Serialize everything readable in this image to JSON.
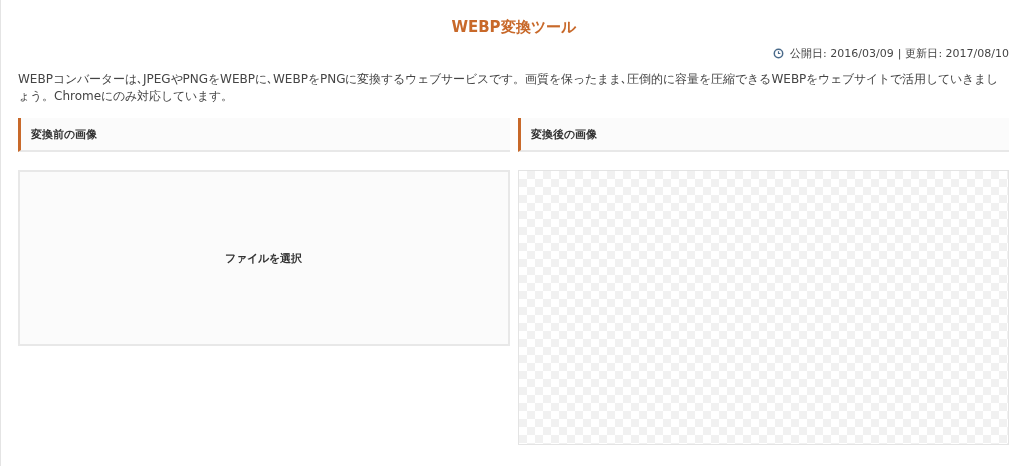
{
  "title": "WEBP変換ツール",
  "dates": {
    "published": "公開日: 2016/03/09",
    "separator": "|",
    "updated": "更新日: 2017/08/10"
  },
  "description": "WEBPコンバーターは､JPEGやPNGをWEBPに､WEBPをPNGに変換するウェブサービスです。画質を保ったまま､圧倒的に容量を圧縮できるWEBPをウェブサイトで活用していきましょう。Chromeにのみ対応しています。",
  "panels": [
    {
      "heading": "変換前の画像",
      "kind": "upload",
      "button": "ファイルを選択"
    },
    {
      "heading": "変換後の画像",
      "kind": "preview"
    }
  ]
}
